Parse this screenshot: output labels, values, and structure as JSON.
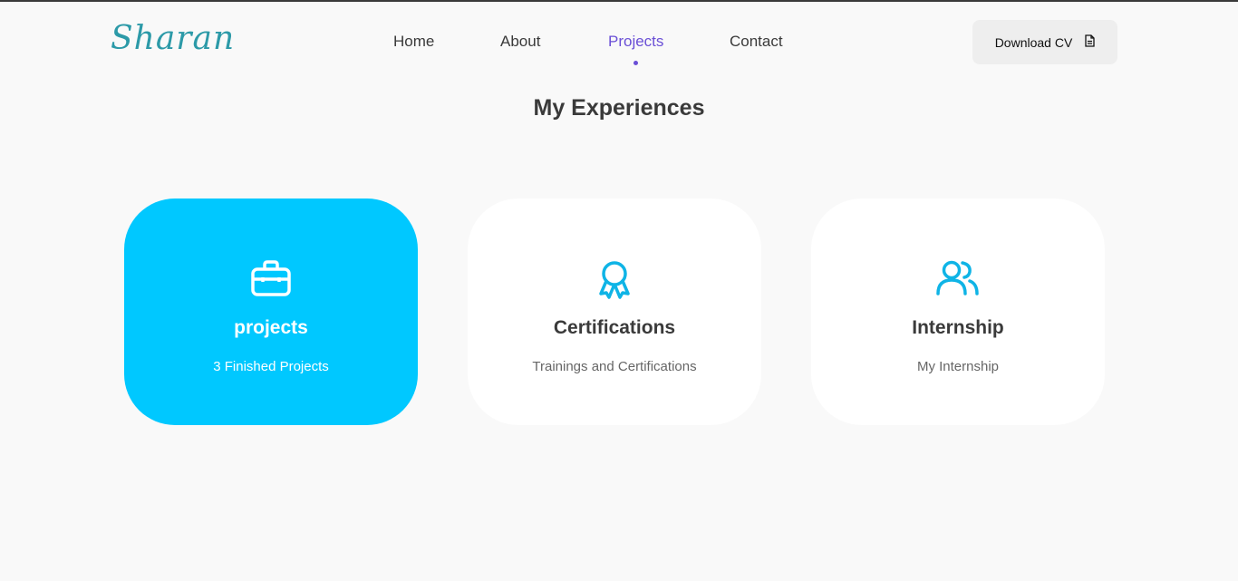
{
  "logo": {
    "text": "Sharan"
  },
  "nav": {
    "items": [
      {
        "label": "Home"
      },
      {
        "label": "About"
      },
      {
        "label": "Projects"
      },
      {
        "label": "Contact"
      }
    ],
    "active": "Projects"
  },
  "download": {
    "label": "Download CV",
    "icon": "file-icon"
  },
  "section": {
    "title": "My Experiences"
  },
  "cards": [
    {
      "title": "projects",
      "subtitle": "3 Finished Projects",
      "icon": "briefcase-icon",
      "active": true
    },
    {
      "title": "Certifications",
      "subtitle": "Trainings and Certifications",
      "icon": "award-icon",
      "active": false
    },
    {
      "title": "Internship",
      "subtitle": "My Internship",
      "icon": "users-icon",
      "active": false
    }
  ],
  "colors": {
    "accent": "#6a4fd6",
    "card_active": "#00c8ff",
    "icon": "#0fb4e6",
    "logo": "#2c9aa8",
    "background": "#f9f9f9"
  }
}
